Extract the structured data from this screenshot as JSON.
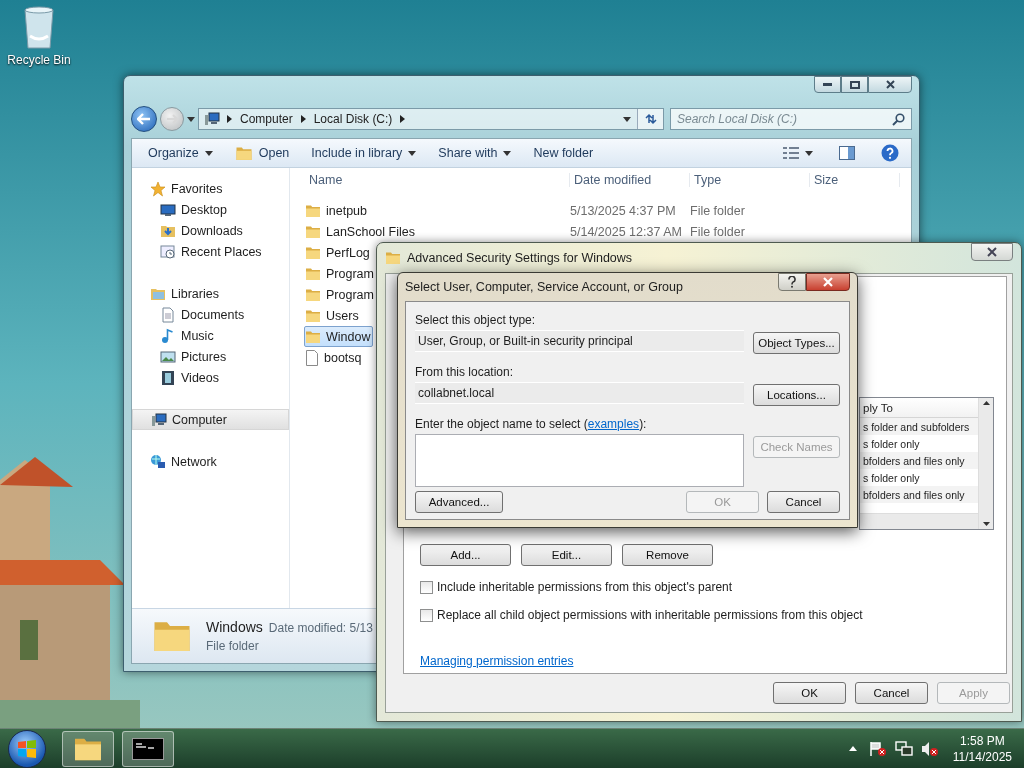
{
  "desktop": {
    "icons": [
      {
        "label": "Recycle Bin"
      }
    ]
  },
  "explorer": {
    "breadcrumbs": [
      "Computer",
      "Local Disk (C:)"
    ],
    "search": {
      "placeholder": "Search Local Disk (C:)"
    },
    "toolbar": [
      {
        "label": "Organize",
        "kind": "menu"
      },
      {
        "label": "Open",
        "kind": "open"
      },
      {
        "label": "Include in library",
        "kind": "menu"
      },
      {
        "label": "Share with",
        "kind": "menu"
      },
      {
        "label": "New folder",
        "kind": "plain"
      }
    ],
    "navigation": [
      {
        "label": "Favorites",
        "kind": "star",
        "selected": false,
        "children": [
          {
            "label": "Desktop",
            "kind": "desktop",
            "selected": false
          },
          {
            "label": "Downloads",
            "kind": "downloads",
            "selected": false
          },
          {
            "label": "Recent Places",
            "kind": "recent",
            "selected": false
          }
        ]
      },
      {
        "label": "Libraries",
        "kind": "libraries",
        "selected": false,
        "children": [
          {
            "label": "Documents",
            "kind": "documents",
            "selected": false
          },
          {
            "label": "Music",
            "kind": "music",
            "selected": false
          },
          {
            "label": "Pictures",
            "kind": "pictures",
            "selected": false
          },
          {
            "label": "Videos",
            "kind": "videos",
            "selected": false
          }
        ]
      },
      {
        "label": "Computer",
        "kind": "computer",
        "selected": true
      },
      {
        "label": "Network",
        "kind": "network",
        "selected": false
      }
    ],
    "columns": [
      "Name",
      "Date modified",
      "Type",
      "Size"
    ],
    "files": [
      {
        "name": "inetpub",
        "date": "5/13/2025 4:37 PM",
        "type": "File folder",
        "kind": "folder",
        "selected": false
      },
      {
        "name": "LanSchool Files",
        "date": "5/14/2025 12:37 AM",
        "type": "File folder",
        "kind": "folder",
        "selected": false
      },
      {
        "name": "PerfLog",
        "kind": "folder",
        "selected": false
      },
      {
        "name": "Program",
        "kind": "folder",
        "selected": false
      },
      {
        "name": "Program",
        "kind": "folder",
        "selected": false
      },
      {
        "name": "Users",
        "kind": "folder",
        "selected": false
      },
      {
        "name": "Window",
        "kind": "folder",
        "selected": true
      },
      {
        "name": "bootsq",
        "kind": "file",
        "selected": false
      }
    ],
    "details": {
      "name": "Windows",
      "meta": "Date modified: 5/13",
      "type": "File folder"
    }
  },
  "security_window": {
    "title": "Advanced Security Settings for Windows",
    "list_header": "ply To",
    "list_rows": [
      "s folder and subfolders",
      "s folder only",
      "bfolders and files only",
      "s folder only",
      "bfolders and files only"
    ],
    "buttons": [
      "Add...",
      "Edit...",
      "Remove"
    ],
    "checkboxes": [
      {
        "label": "Include inheritable permissions from this object's parent",
        "checked": false
      },
      {
        "label": "Replace all child object permissions with inheritable permissions from this object",
        "checked": false
      }
    ],
    "link": "Managing permission entries",
    "footer": [
      {
        "label": "OK",
        "disabled": false
      },
      {
        "label": "Cancel",
        "disabled": false
      },
      {
        "label": "Apply",
        "disabled": true
      }
    ]
  },
  "select_dialog": {
    "title": "Select User, Computer, Service Account, or Group",
    "object_type_label": "Select this object type:",
    "object_type": "User, Group, or Built-in security principal",
    "object_types_button": "Object Types...",
    "location_label": "From this location:",
    "location": "collabnet.local",
    "locations_button": "Locations...",
    "name_label_before": "Enter the object name to select (",
    "name_link": "examples",
    "name_label_after": "):",
    "check_names": {
      "label": "Check Names",
      "disabled": true
    },
    "advanced_button": "Advanced...",
    "buttons": [
      {
        "label": "OK",
        "disabled": true
      },
      {
        "label": "Cancel",
        "disabled": false
      }
    ]
  },
  "taskbar": {
    "time": "1:58 PM",
    "date": "11/14/2025"
  }
}
